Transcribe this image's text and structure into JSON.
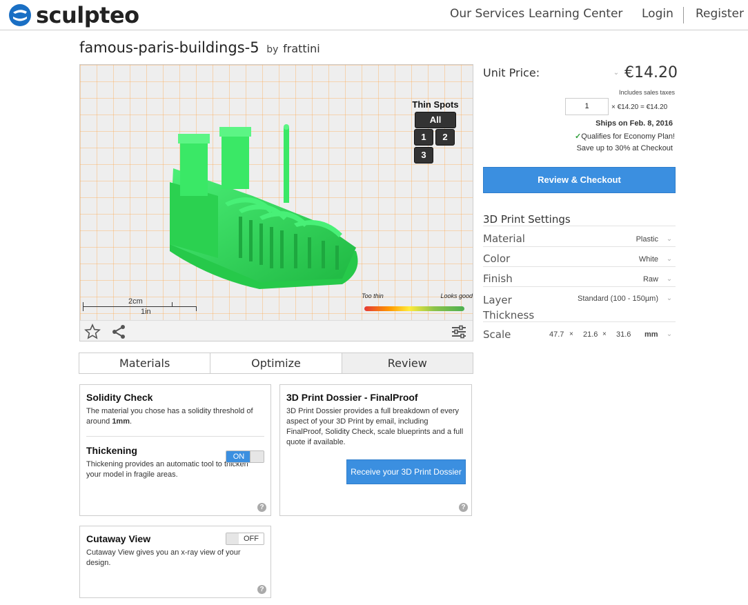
{
  "header": {
    "logo_text": "sculpteo",
    "nav": [
      "Our Services",
      "Learning Center",
      "Login",
      "Register"
    ]
  },
  "product": {
    "title": "famous-paris-buildings-5",
    "by": "by",
    "author": "frattini"
  },
  "viewer": {
    "thin_spots_title": "Thin Spots",
    "thin_spots_buttons": [
      "All",
      "1",
      "2",
      "3"
    ],
    "scale_cm": "2cm",
    "scale_in": "1in",
    "thin_label_left": "Too thin",
    "thin_label_right": "Looks good",
    "model_color": "#33e05a"
  },
  "tabs": [
    "Materials",
    "Optimize",
    "Review"
  ],
  "panels": {
    "solidity": {
      "title": "Solidity Check",
      "text_pre": "The material you chose has a solidity threshold of around ",
      "text_bold": "1mm",
      "text_post": "."
    },
    "thickening": {
      "title": "Thickening",
      "toggle": "ON",
      "text": "Thickening provides an automatic tool to thicken your model in fragile areas."
    },
    "dossier": {
      "title": "3D Print Dossier - FinalProof",
      "text": "3D Print Dossier provides a full breakdown of every aspect of your 3D Print by email, including FinalProof, Solidity Check, scale blueprints and a full quote if available.",
      "button": "Receive your 3D Print Dossier"
    },
    "cutaway": {
      "title": "Cutaway View",
      "toggle": "OFF",
      "text": "Cutaway View gives you an x-ray view of your design."
    },
    "help": "?"
  },
  "pricing": {
    "unit_price_label": "Unit Price:",
    "price": "€14.20",
    "taxes": "Includes sales taxes",
    "quantity": "1",
    "calc": "× €14.20 = €14.20",
    "ships": "Ships on Feb. 8, 2016",
    "economy": "Qualifies for Economy Plan!",
    "save": "Save up to 30% at Checkout",
    "checkout_button": "Review & Checkout"
  },
  "settings": {
    "title": "3D Print Settings",
    "material": {
      "label": "Material",
      "value": "Plastic"
    },
    "color": {
      "label": "Color",
      "value": "White"
    },
    "finish": {
      "label": "Finish",
      "value": "Raw"
    },
    "layer": {
      "label": "Layer Thickness",
      "label_line1": "Layer",
      "label_line2": "Thickness",
      "value": "Standard (100 - 150µm)"
    },
    "scale": {
      "label": "Scale",
      "x": "47.7",
      "y": "21.6",
      "z": "31.6",
      "sep": "×",
      "unit": "mm"
    }
  },
  "colors": {
    "accent_blue": "#3b8fe0",
    "check_green": "#2e9e3a"
  }
}
